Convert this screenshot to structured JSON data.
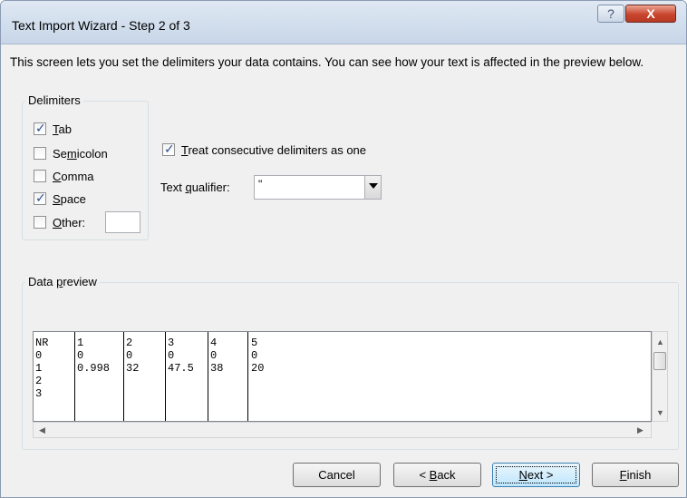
{
  "window": {
    "title": "Text Import Wizard - Step 2 of 3",
    "help_glyph": "?",
    "close_glyph": "X"
  },
  "description": "This screen lets you set the delimiters your data contains.  You can see how your text is affected in the preview below.",
  "delimiters": {
    "legend": "Delimiters",
    "items": [
      {
        "pre": "",
        "accel": "T",
        "post": "ab",
        "checked": true
      },
      {
        "pre": "Se",
        "accel": "m",
        "post": "icolon",
        "checked": false
      },
      {
        "pre": "",
        "accel": "C",
        "post": "omma",
        "checked": false
      },
      {
        "pre": "",
        "accel": "S",
        "post": "pace",
        "checked": true
      },
      {
        "pre": "",
        "accel": "O",
        "post": "ther:",
        "checked": false
      }
    ],
    "other_value": ""
  },
  "consecutive": {
    "pre": "",
    "accel": "T",
    "post": "reat consecutive delimiters as one",
    "checked": true
  },
  "qualifier": {
    "label_pre": "Text ",
    "label_accel": "q",
    "label_post": "ualifier:",
    "value": "\""
  },
  "preview": {
    "legend_pre": "Data ",
    "legend_accel": "p",
    "legend_post": "review",
    "columns": [
      [
        "NR",
        "0",
        "1",
        "2",
        "3"
      ],
      [
        "1",
        "0",
        "0.998",
        "",
        ""
      ],
      [
        "2",
        "0",
        "32",
        "",
        ""
      ],
      [
        "3",
        "0",
        "47.5",
        "",
        ""
      ],
      [
        "4",
        "0",
        "38",
        "",
        ""
      ],
      [
        "5",
        "0",
        "20",
        "",
        ""
      ]
    ]
  },
  "buttons": {
    "cancel": "Cancel",
    "back_pre": "< ",
    "back_accel": "B",
    "back_post": "ack",
    "next_pre": "",
    "next_accel": "N",
    "next_post": "ext >",
    "finish_pre": "",
    "finish_accel": "F",
    "finish_post": "inish"
  },
  "icons": {
    "check": "checkmark-icon",
    "dropdown": "chevron-down-icon",
    "scroll_up": "scroll-up-arrow-icon",
    "scroll_down": "scroll-down-arrow-icon",
    "scroll_left": "scroll-left-arrow-icon",
    "scroll_right": "scroll-right-arrow-icon"
  },
  "colors": {
    "title_bar": "#c7d6e8",
    "close_button": "#c8452e",
    "default_button": "#bee6fd"
  }
}
